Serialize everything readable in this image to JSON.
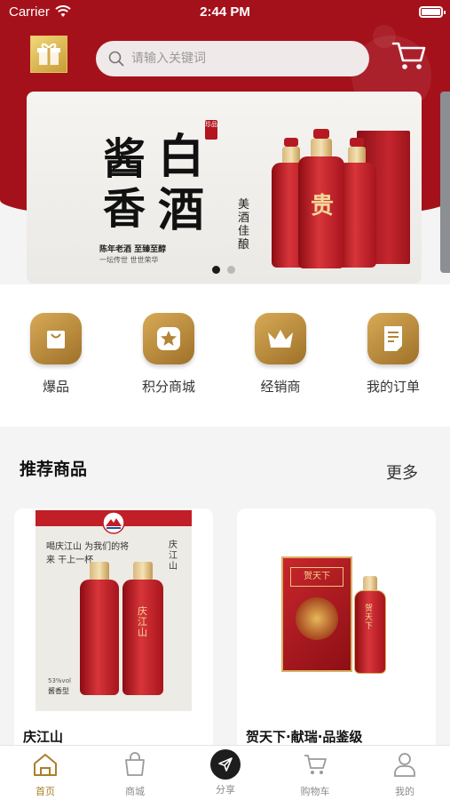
{
  "status_bar": {
    "carrier": "Carrier",
    "time": "2:44 PM"
  },
  "search": {
    "placeholder": "请输入关键词"
  },
  "banner": {
    "title_chars": [
      "酱",
      "香",
      "白",
      "酒"
    ],
    "stamp": "珍品",
    "slogan_line1": "陈年老酒 至臻至醇",
    "slogan_line2": "一坛传世 世世荣华",
    "vertical_text": "美酒佳酿",
    "bottle_mark": "贵",
    "pages": 2,
    "active_page": 1
  },
  "categories": [
    {
      "label": "爆品",
      "icon": "shopping-bag-icon"
    },
    {
      "label": "积分商城",
      "icon": "star-icon"
    },
    {
      "label": "经销商",
      "icon": "crown-icon"
    },
    {
      "label": "我的订单",
      "icon": "order-list-icon"
    }
  ],
  "recommend": {
    "title": "推荐商品",
    "more": "更多",
    "products": [
      {
        "name": "庆江山",
        "poster_text": "喝庆江山 为我们的将来 干上一杯",
        "side_text": "庆江山",
        "bottle_label": "庆江山",
        "abv": "53%vol",
        "style": "酱香型"
      },
      {
        "name": "贺天下·献瑞·品鉴级",
        "box_label": "贺天下",
        "bottle_label": "贺天下"
      }
    ]
  },
  "tabbar": {
    "active": 0,
    "items": [
      {
        "label": "首页",
        "icon": "home-icon"
      },
      {
        "label": "商城",
        "icon": "shopping-bag-icon"
      },
      {
        "label": "分享",
        "icon": "share-send-icon"
      },
      {
        "label": "购物车",
        "icon": "cart-icon"
      },
      {
        "label": "我的",
        "icon": "user-icon"
      }
    ]
  },
  "colors": {
    "brand_red": "#a5111b",
    "gold": "#b8893a",
    "active_tab": "#a87f2a"
  }
}
